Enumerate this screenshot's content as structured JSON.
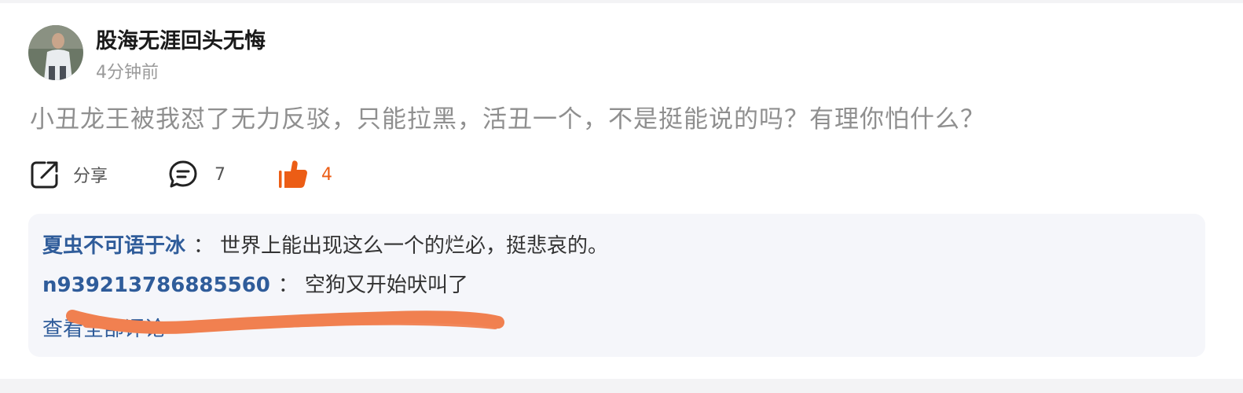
{
  "post": {
    "author": "股海无涯回头无悔",
    "time": "4分钟前",
    "content": "小丑龙王被我怼了无力反驳，只能拉黑，活丑一个，不是挺能说的吗？有理你怕什么？"
  },
  "actions": {
    "share_label": "分享",
    "comment_count": "7",
    "like_count": "4"
  },
  "comments": [
    {
      "name": "夏虫不可语于冰",
      "separator": "：",
      "text": "世界上能出现这么一个的烂必，挺悲哀的。"
    },
    {
      "name": "n939213786885560",
      "separator": "：",
      "text": "空狗又开始吠叫了"
    }
  ],
  "view_all_label": "查看全部评论",
  "colors": {
    "like_accent": "#ec5d15",
    "commenter_name": "#2f5c9a",
    "scribble": "#f08050"
  },
  "icons": {
    "share": "share-icon",
    "comment": "comment-bubble-icon",
    "like": "thumbs-up-icon"
  }
}
